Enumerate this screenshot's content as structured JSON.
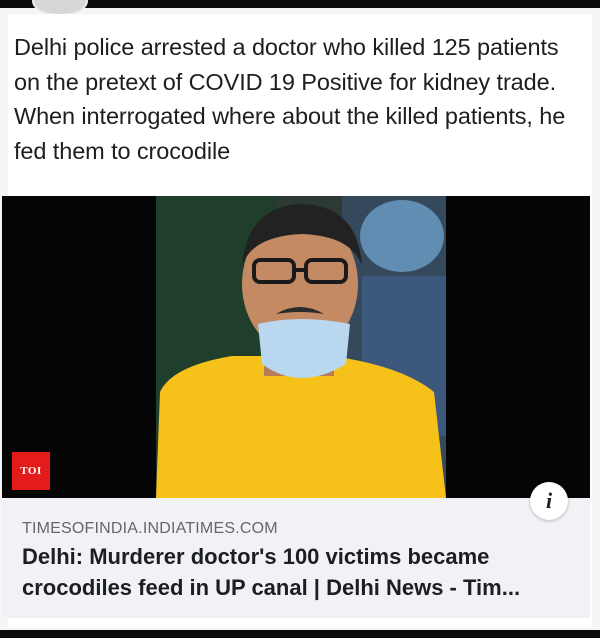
{
  "post": {
    "text": "Delhi police arrested a doctor who killed 125 patients on the pretext of COVID 19 Positive for kidney trade. When interrogated where about the killed patients, he fed them to crocodile"
  },
  "media": {
    "badge": "TOI",
    "info_icon": "i"
  },
  "link": {
    "domain": "TIMESOFINDIA.INDIATIMES.COM",
    "title": "Delhi: Murderer doctor's 100 victims became crocodiles feed in UP canal | Delhi News - Tim..."
  },
  "colors": {
    "badge_red": "#e41b1b",
    "shirt_yellow": "#f6c21a",
    "mask_blue": "#b9d7ee",
    "preview_bg": "#f0f2f5"
  }
}
